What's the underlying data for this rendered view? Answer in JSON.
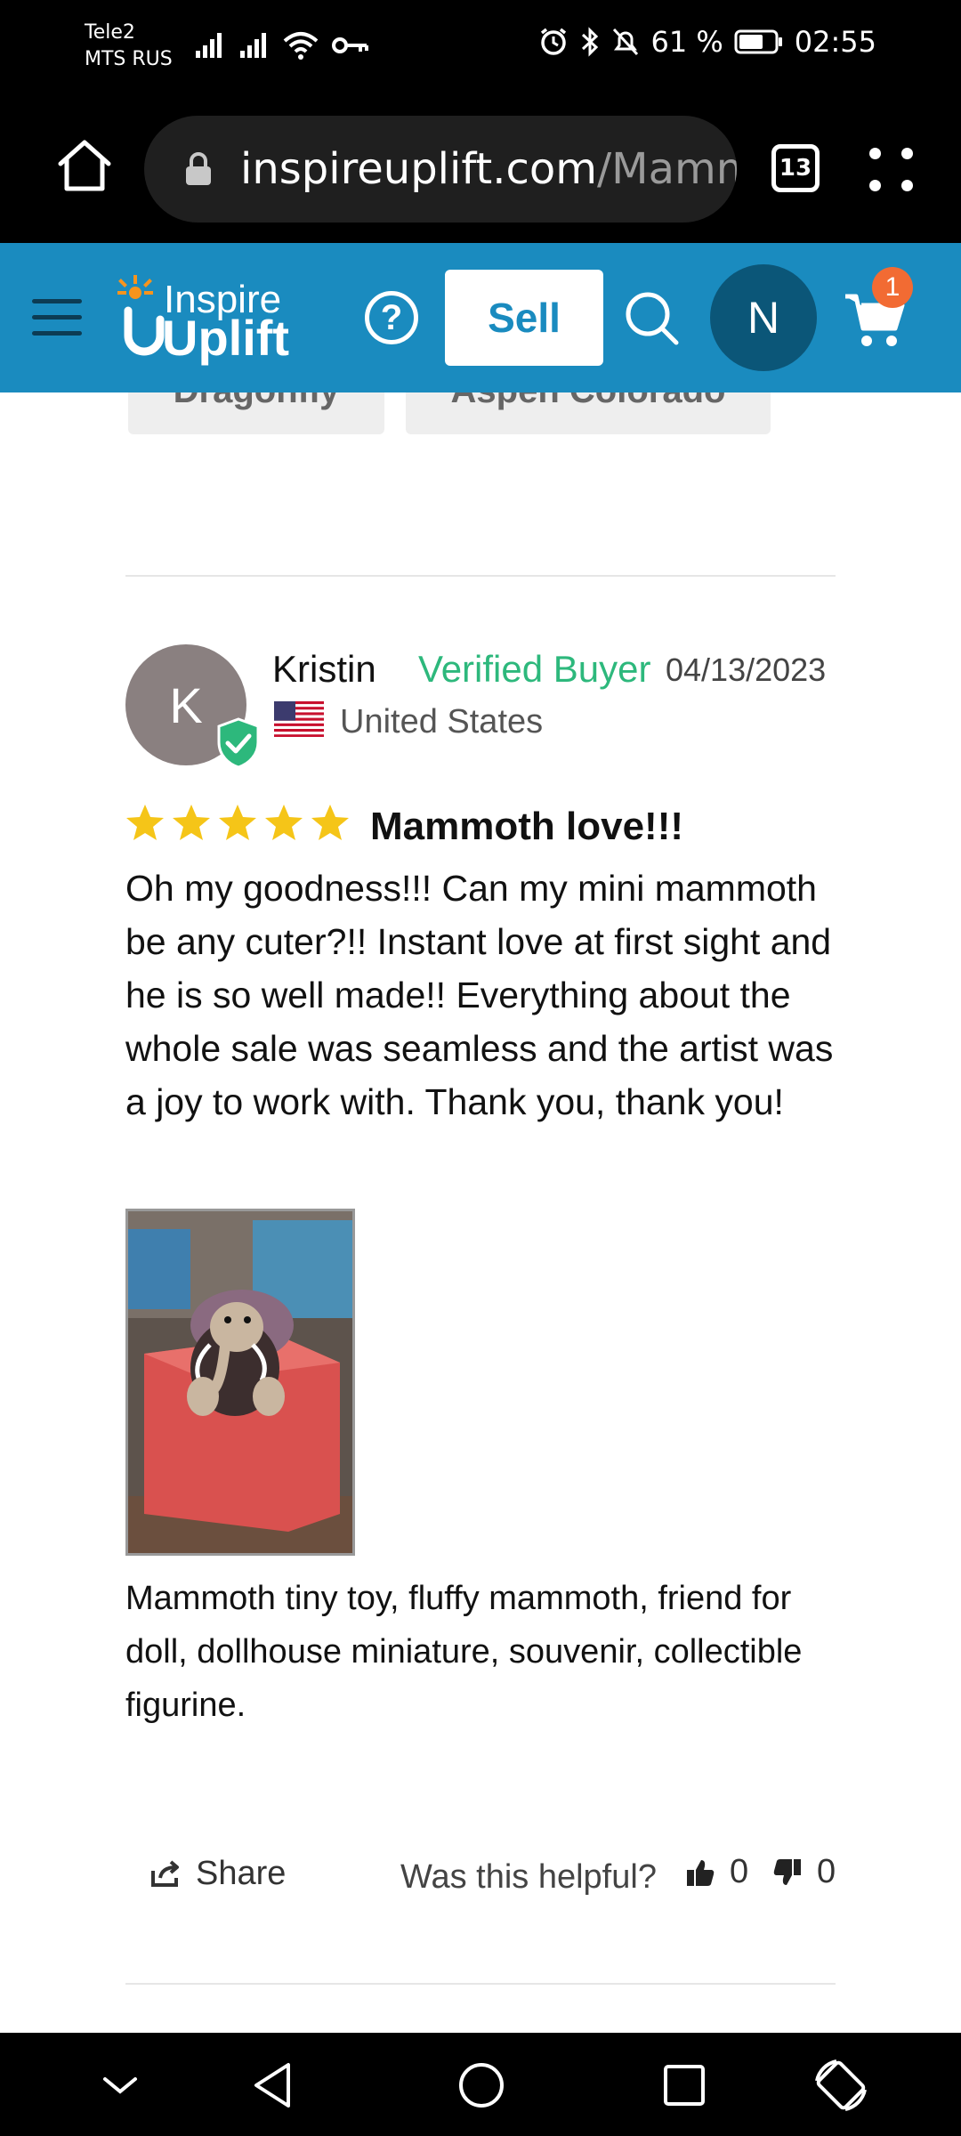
{
  "status_bar": {
    "carrier_1": "Tele2",
    "carrier_2": "MTS RUS",
    "battery": "61 %",
    "time": "02:55"
  },
  "browser": {
    "url_domain": "inspireuplift.com",
    "url_path": "/Mamm",
    "tab_count": "13"
  },
  "header": {
    "logo_line1": "Inspire",
    "logo_line2": "Uplift",
    "help_symbol": "?",
    "sell_label": "Sell",
    "user_initial": "N",
    "cart_count": "1",
    "brand_color": "#1a8bbf"
  },
  "tags": [
    "Dragonfly",
    "Aspen Colorado"
  ],
  "review": {
    "avatar_initial": "K",
    "reviewer_name": "Kristin",
    "verified_label": "Verified Buyer",
    "date": "04/13/2023",
    "country": "United States",
    "rating": 5,
    "title": "Mammoth love!!!",
    "body": "Oh my goodness!!! Can my mini mammoth be any cuter?!! Instant love at first sight and he is so well made!! Everything about the whole sale was seamless and the artist was a joy to work with. Thank you, thank you!",
    "photo_caption": "Mammoth tiny toy, fluffy mammoth, friend for doll, dollhouse miniature, souvenir, collectible figurine.",
    "share_label": "Share",
    "helpful_label": "Was this helpful?",
    "helpful_up": "0",
    "helpful_down": "0",
    "verified_color": "#2db87c",
    "star_color": "#f5c518"
  }
}
